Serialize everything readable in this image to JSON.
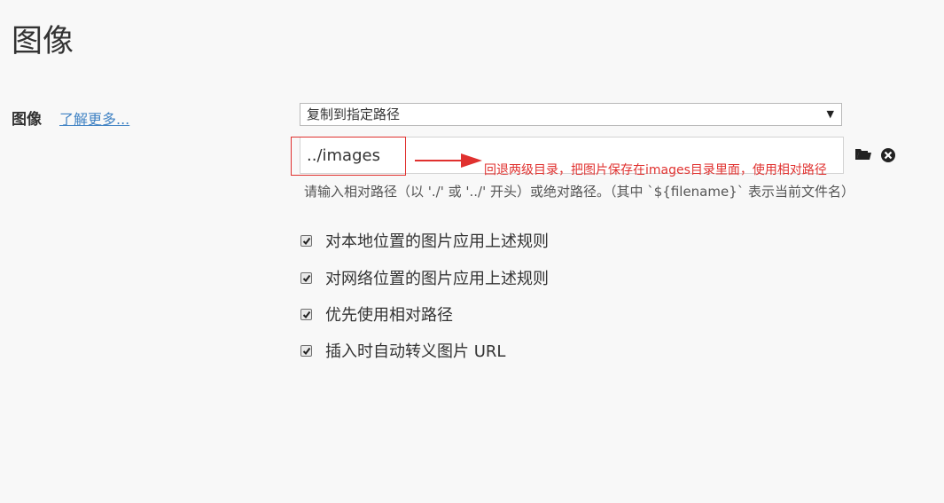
{
  "page": {
    "title": "图像"
  },
  "image_row": {
    "label": "图像",
    "learn_more": "了解更多..."
  },
  "select": {
    "value": "复制到指定路径"
  },
  "path_input": {
    "value": "../images"
  },
  "annotation": {
    "text": "回退两级目录，把图片保存在images目录里面，使用相对路径",
    "color": "#e0312f"
  },
  "hint": "请输入相对路径（以 './' 或 '../' 开头）或绝对路径。（其中 `${filename}` 表示当前文件名）",
  "options": [
    {
      "label": "对本地位置的图片应用上述规则",
      "checked": true
    },
    {
      "label": "对网络位置的图片应用上述规则",
      "checked": true
    },
    {
      "label": "优先使用相对路径",
      "checked": true
    },
    {
      "label": "插入时自动转义图片 URL",
      "checked": true
    }
  ],
  "icons": {
    "folder": "folder-icon",
    "clear": "clear-icon"
  }
}
